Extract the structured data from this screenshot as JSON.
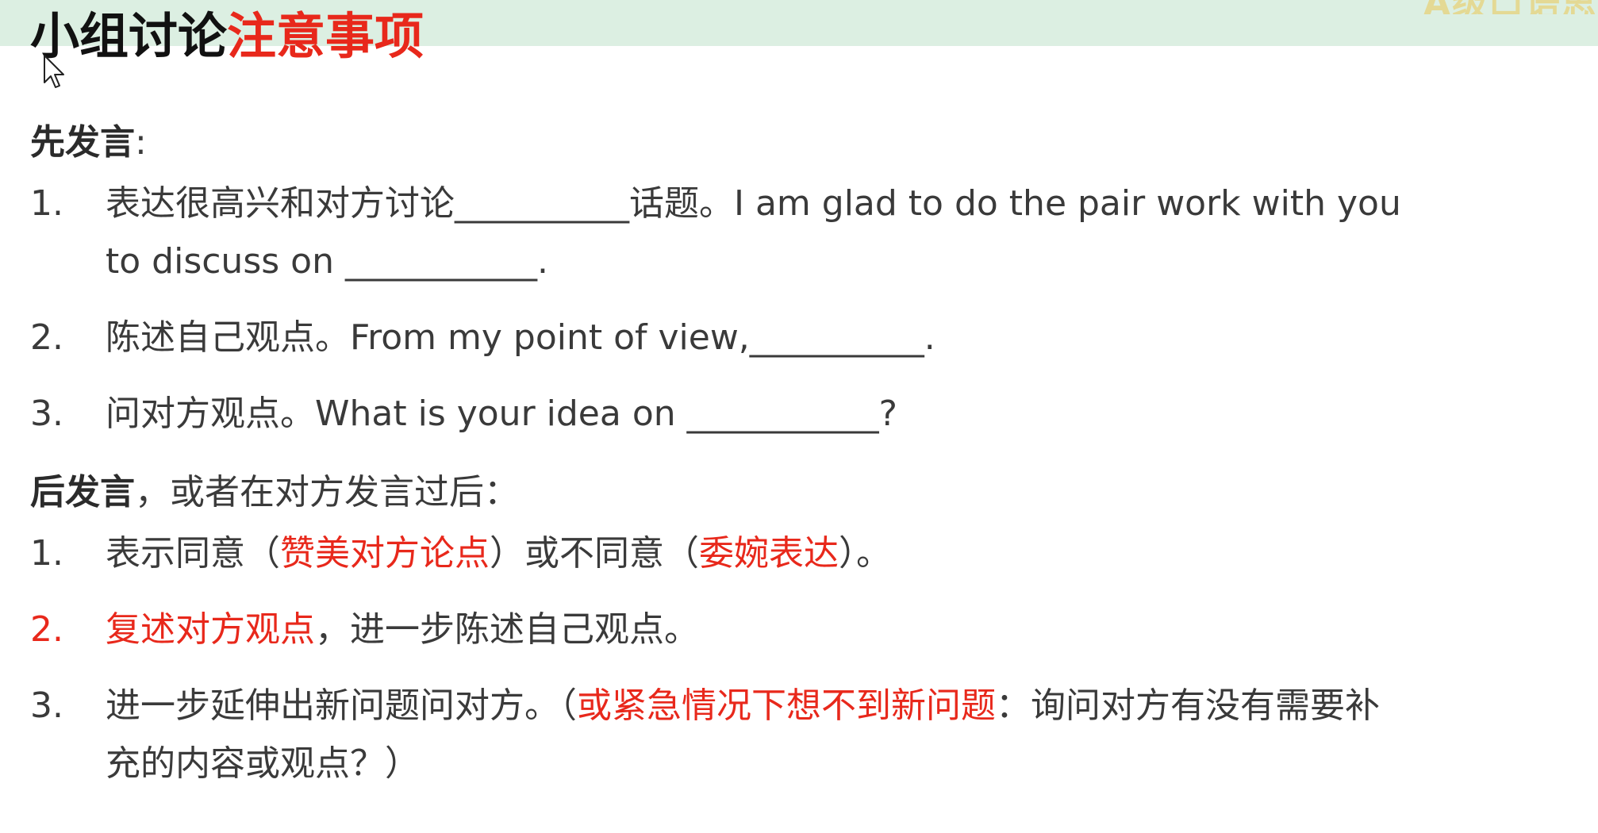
{
  "title": {
    "part1": "小组讨论",
    "part2": "注意事项"
  },
  "corner_logo": {
    "text": "A级口语思"
  },
  "first_speaker": {
    "heading": "先发言",
    "colon": ":",
    "items": [
      {
        "num": "1.",
        "line1": "表达很高兴和对方讨论__________话题。I am glad to do the pair work with you",
        "line2": "to discuss on ___________."
      },
      {
        "num": "2.",
        "text": "陈述自己观点。From my point of view,__________."
      },
      {
        "num": "3.",
        "text": "问对方观点。What is your idea on ___________?"
      }
    ]
  },
  "second_speaker": {
    "heading": "后发言",
    "heading_rest": "，或者在对方发言过后：",
    "item1": {
      "num": "1.",
      "a": "表示同意（",
      "b": "赞美对方论点",
      "c": "）或不同意（",
      "d": "委婉表达",
      "e": "）。"
    },
    "item2": {
      "num": "2.",
      "a": "复述对方观点",
      "b": "，进一步陈述自己观点。"
    },
    "item3": {
      "num": "3.",
      "a": "进一步延伸出新问题问对方。（",
      "b": "或紧急情况下想不到新问题",
      "c": "：询问对方有没有需要补",
      "d": "充的内容或观点？）"
    }
  },
  "colors": {
    "accent_red": "#e8281b",
    "top_band": "#dcefe2",
    "body_text": "#3a3a3a"
  }
}
